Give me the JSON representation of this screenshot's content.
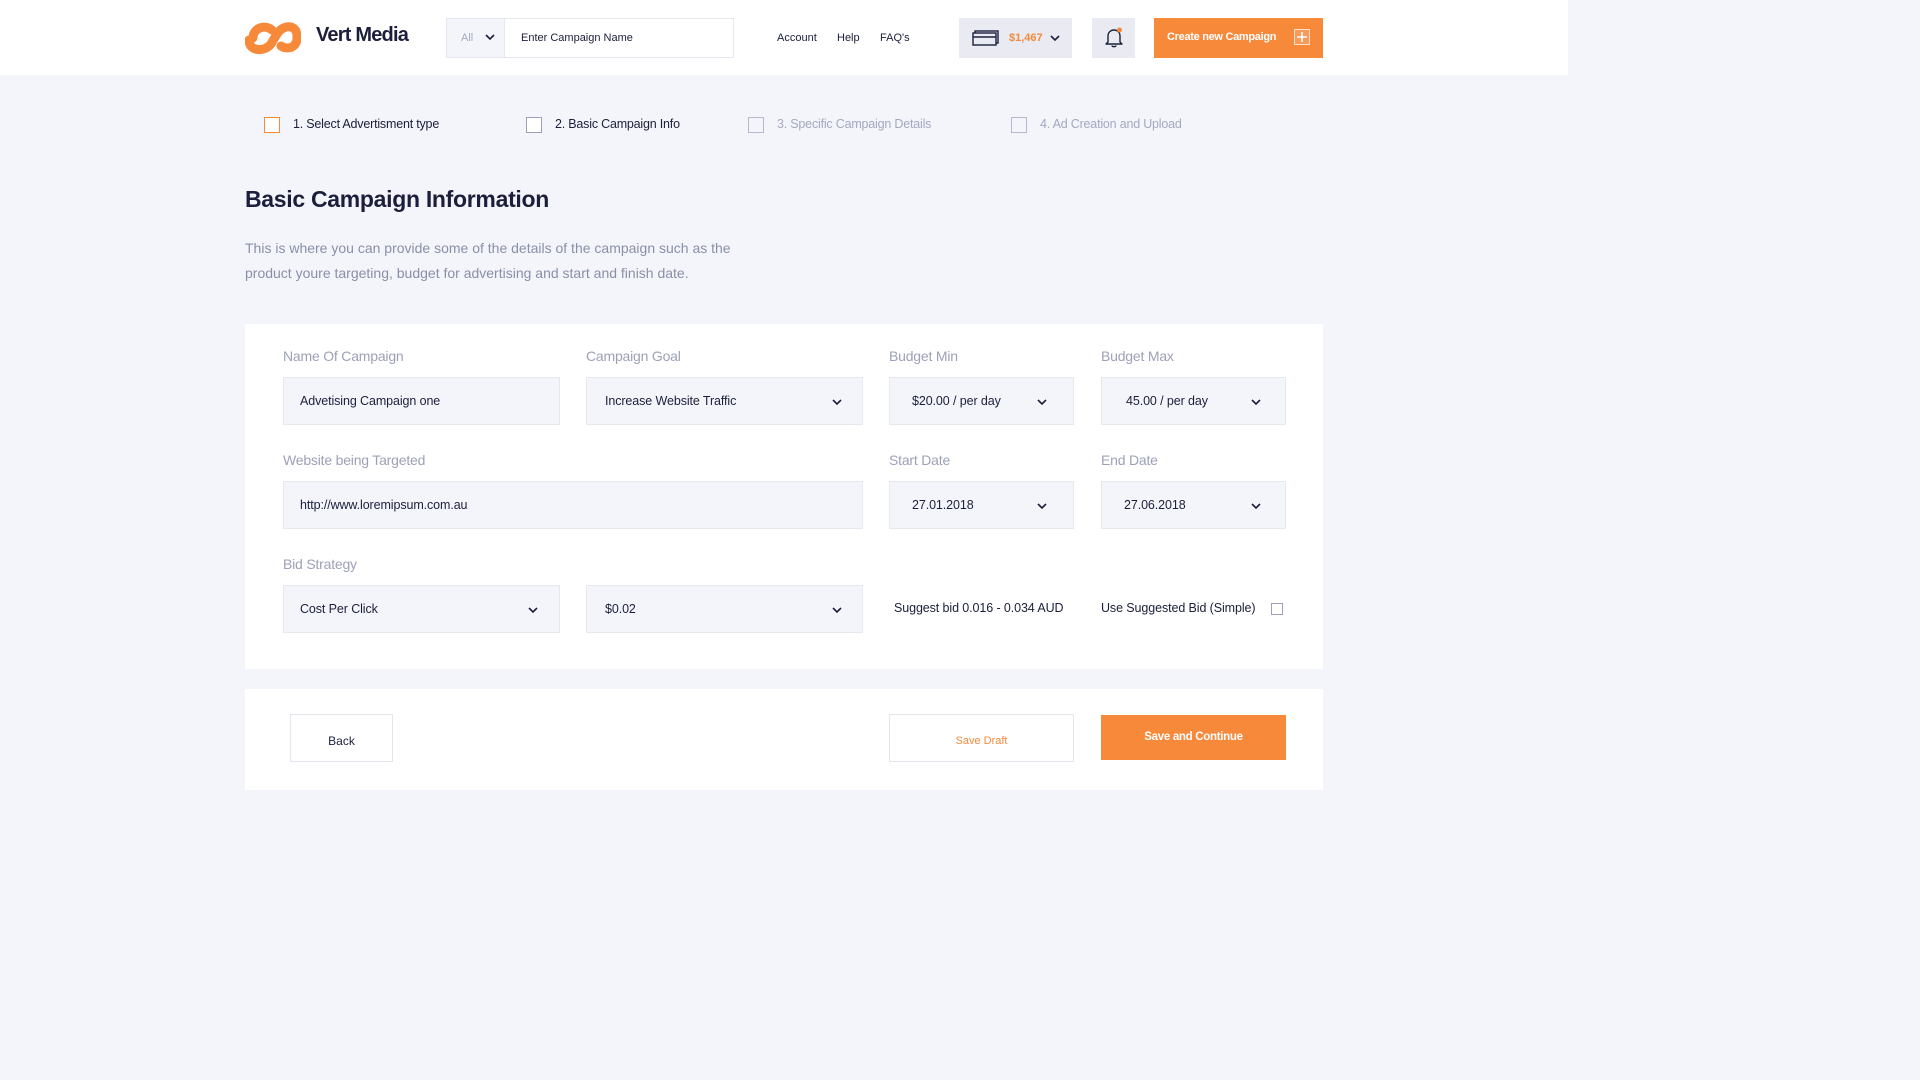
{
  "brand": {
    "name": "Vert Media",
    "logo_icon": "brand-logo-icon",
    "accent": "#f7893b"
  },
  "header": {
    "search": {
      "filter_value": "All",
      "placeholder": "Enter Campaign Name"
    },
    "nav": [
      "Account",
      "Help",
      "FAQ's"
    ],
    "wallet": {
      "icon": "credit-card-icon",
      "amount": "$1,467"
    },
    "notifications": {
      "icon": "bell-icon",
      "has_unread": true
    },
    "create_button": {
      "label": "Create new Campaign",
      "icon": "plus-icon"
    }
  },
  "steps": [
    {
      "label": "1. Select Advertisment type",
      "state": "current"
    },
    {
      "label": "2. Basic Campaign Info",
      "state": "done"
    },
    {
      "label": "3. Specific Campaign Details",
      "state": "disabled"
    },
    {
      "label": "4. Ad Creation and Upload",
      "state": "disabled"
    }
  ],
  "page": {
    "title": "Basic Campaign Information",
    "description": "This is where you can provide some of the details of the campaign such as the product youre targeting, budget for advertising and start and finish date."
  },
  "form": {
    "campaign_name": {
      "label": "Name Of Campaign",
      "value": "Advetising Campaign one"
    },
    "campaign_goal": {
      "label": "Campaign Goal",
      "value": "Increase Website Traffic"
    },
    "budget_min": {
      "label": "Budget Min",
      "value": "$20.00 / per day"
    },
    "budget_max": {
      "label": "Budget Max",
      "value": "45.00 / per day"
    },
    "website": {
      "label": "Website being Targeted",
      "value": "http://www.loremipsum.com.au"
    },
    "start_date": {
      "label": "Start Date",
      "value": "27.01.2018"
    },
    "end_date": {
      "label": "End Date",
      "value": "27.06.2018"
    },
    "bid_strategy": {
      "label": "Bid Strategy",
      "value": "Cost Per Click",
      "amount": "$0.02"
    },
    "suggested_bid": "Suggest bid 0.016 - 0.034 AUD",
    "use_suggested": {
      "label": "Use Suggested Bid (Simple)",
      "checked": false
    }
  },
  "actions": {
    "back": "Back",
    "save_draft": "Save Draft",
    "save_continue": "Save and Continue"
  }
}
